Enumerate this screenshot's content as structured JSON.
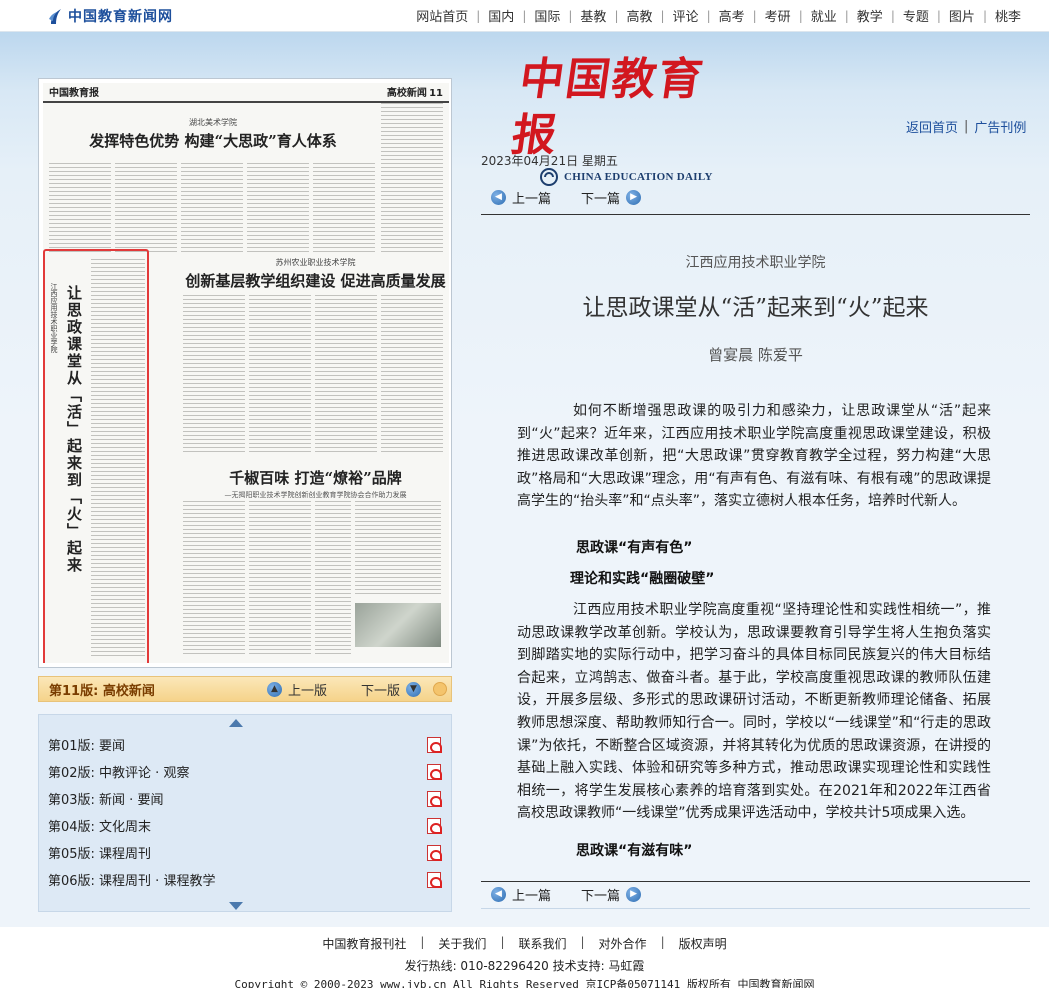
{
  "site": {
    "logo_text": "中国教育新闻网",
    "nav": [
      "网站首页",
      "国内",
      "国际",
      "基教",
      "高教",
      "评论",
      "高考",
      "考研",
      "就业",
      "教学",
      "专题",
      "图片",
      "桃李"
    ]
  },
  "masthead": {
    "title": "中国教育报",
    "subtitle": "CHINA EDUCATION DAILY",
    "links": [
      "返回首页",
      "广告刊例"
    ]
  },
  "paper": {
    "header_left": "中国教育报",
    "header_right": "高校新闻",
    "header_page": "11",
    "story1_kicker": "湖北美术学院",
    "story1_title": "发挥特色优势 构建“大思政”育人体系",
    "story2_kicker": "苏州农业职业技术学院",
    "story2_title": "创新基层教学组织建设 促进高质量发展",
    "story3_title": "千椒百味 打造“燎裕”品牌",
    "story3_sub": "—无揭阳职业技术学院创新创业教育学院协会合作助力发展",
    "vertical_school": "江西应用技术职业学院",
    "vertical_title": "让思政课堂从「活」起来到「火」起来"
  },
  "version_bar": {
    "current": "第11版: 高校新闻",
    "prev": "上一版",
    "next": "下一版"
  },
  "versions": [
    "第01版: 要闻",
    "第02版: 中教评论 · 观察",
    "第03版: 新闻 · 要闻",
    "第04版: 文化周末",
    "第05版: 课程周刊",
    "第06版: 课程周刊 · 课程教学"
  ],
  "article": {
    "date": "2023年04月21日 星期五",
    "prev": "上一篇",
    "next": "下一篇",
    "school": "江西应用技术职业学院",
    "title": "让思政课堂从“活”起来到“火”起来",
    "authors": "曾宴晨 陈爱平",
    "para1": "如何不断增强思政课的吸引力和感染力，让思政课堂从“活”起来到“火”起来？近年来，江西应用技术职业学院高度重视思政课堂建设，积极推进思政课改革创新，把“大思政课”贯穿教育教学全过程，努力构建“大思政”格局和“大思政课”理念，用“有声有色、有滋有味、有根有魂”的思政课提高学生的“抬头率”和“点头率”，落实立德树人根本任务，培养时代新人。",
    "subhead1": "思政课“有声有色”",
    "subhead2": "理论和实践“融圈破壁”",
    "para2": "江西应用技术职业学院高度重视“坚持理论性和实践性相统一”，推动思政课教学改革创新。学校认为，思政课要教育引导学生将人生抱负落实到脚踏实地的实际行动中，把学习奋斗的具体目标同民族复兴的伟大目标结合起来，立鸿鹄志、做奋斗者。基于此，学校高度重视思政课的教师队伍建设，开展多层级、多形式的思政课研讨活动，不断更新教师理论储备、拓展教师思想深度、帮助教师知行合一。同时，学校以“一线课堂”和“行走的思政课”为依托，不断整合区域资源，并将其转化为优质的思政课资源，在讲授的基础上融入实践、体验和研究等多种方式，推动思政课实现理论性和实践性相统一，将学生发展核心素养的培育落到实处。在2021年和2022年江西省高校思政课教师“一线课堂”优秀成果评选活动中，学校共计5项成果入选。",
    "subhead3": "思政课“有滋有味”"
  },
  "footer": {
    "links": [
      "中国教育报刊社",
      "关于我们",
      "联系我们",
      "对外合作",
      "版权声明"
    ],
    "line2": "发行热线: 010-82296420 技术支持: 马虹霞",
    "line3": "Copyright © 2000-2023 www.jyb.cn All Rights Reserved 京ICP备05071141 版权所有 中国教育新闻网"
  }
}
